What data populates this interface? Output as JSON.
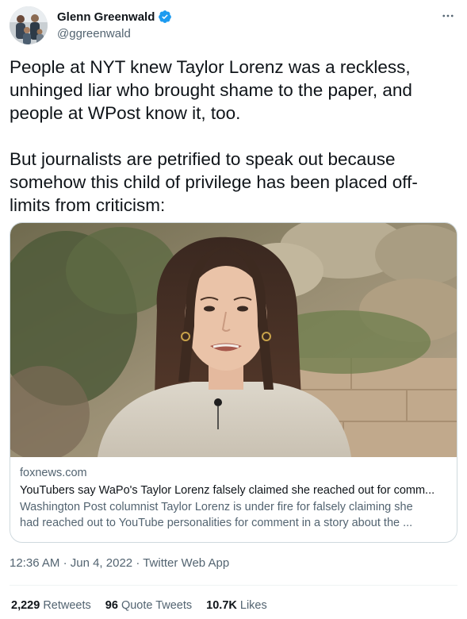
{
  "author": {
    "name": "Glenn Greenwald",
    "handle": "@ggreenwald",
    "verified": true
  },
  "more_icon": "more-options-icon",
  "tweet": {
    "paragraphs": [
      "People at NYT knew Taylor Lorenz was a reckless,\nunhinged liar who brought shame to the paper, and\npeople at WPost know it, too.",
      "But journalists are petrified to speak out because\nsomehow this child of privilege has been placed off-\nlimits from criticism:"
    ]
  },
  "link_card": {
    "domain": "foxnews.com",
    "title": "YouTubers say WaPo's Taylor Lorenz falsely claimed she reached out for comm...",
    "description_lines": [
      "Washington Post columnist Taylor Lorenz is under fire for falsely claiming she",
      "had reached out to YouTube personalities for comment in a story about the ..."
    ]
  },
  "meta": {
    "time": "12:36 AM",
    "date": "Jun 4, 2022",
    "source": "Twitter Web App",
    "separator": "·"
  },
  "stats": {
    "retweets": {
      "count": "2,229",
      "label": "Retweets"
    },
    "quote_tweets": {
      "count": "96",
      "label": "Quote Tweets"
    },
    "likes": {
      "count": "10.7K",
      "label": "Likes"
    }
  },
  "colors": {
    "text_primary": "#0f1419",
    "text_secondary": "#536471",
    "verified_blue": "#1d9bf0",
    "border": "#cfd9de"
  }
}
